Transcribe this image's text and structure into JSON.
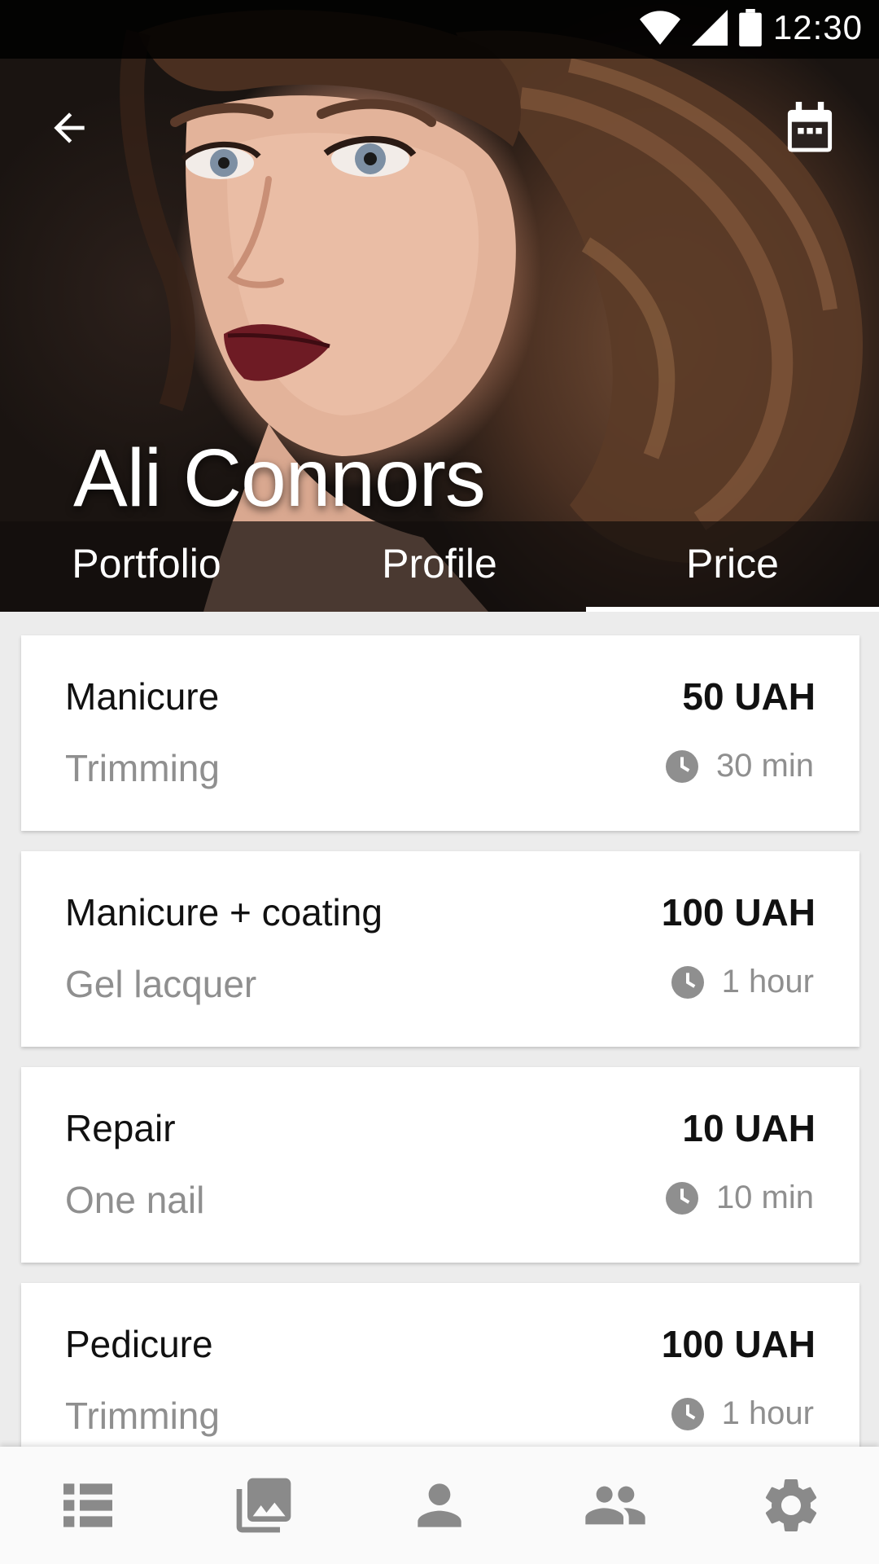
{
  "status_bar": {
    "time": "12:30",
    "icons": [
      "wifi-icon",
      "signal-icon",
      "battery-icon"
    ]
  },
  "app_bar": {
    "back_icon": "arrow-back-icon",
    "action_icon": "calendar-icon"
  },
  "profile": {
    "name": "Ali Connors"
  },
  "tabs": [
    {
      "label": "Portfolio",
      "selected": false
    },
    {
      "label": "Profile",
      "selected": false
    },
    {
      "label": "Price",
      "selected": true
    }
  ],
  "services": [
    {
      "name": "Manicure",
      "price": "50 UAH",
      "detail": "Trimming",
      "duration": "30 min"
    },
    {
      "name": "Manicure + coating",
      "price": "100 UAH",
      "detail": "Gel lacquer",
      "duration": "1 hour"
    },
    {
      "name": "Repair",
      "price": "10 UAH",
      "detail": "One nail",
      "duration": "10 min"
    },
    {
      "name": "Pedicure",
      "price": "100 UAH",
      "detail": "Trimming",
      "duration": "1 hour"
    }
  ],
  "bottom_nav": [
    "list-icon",
    "gallery-icon",
    "person-icon",
    "people-icon",
    "settings-icon"
  ],
  "colors": {
    "text_primary": "#111111",
    "text_secondary": "#8f8f8f",
    "nav_icon": "#8a8a8a",
    "background": "#ececec"
  }
}
